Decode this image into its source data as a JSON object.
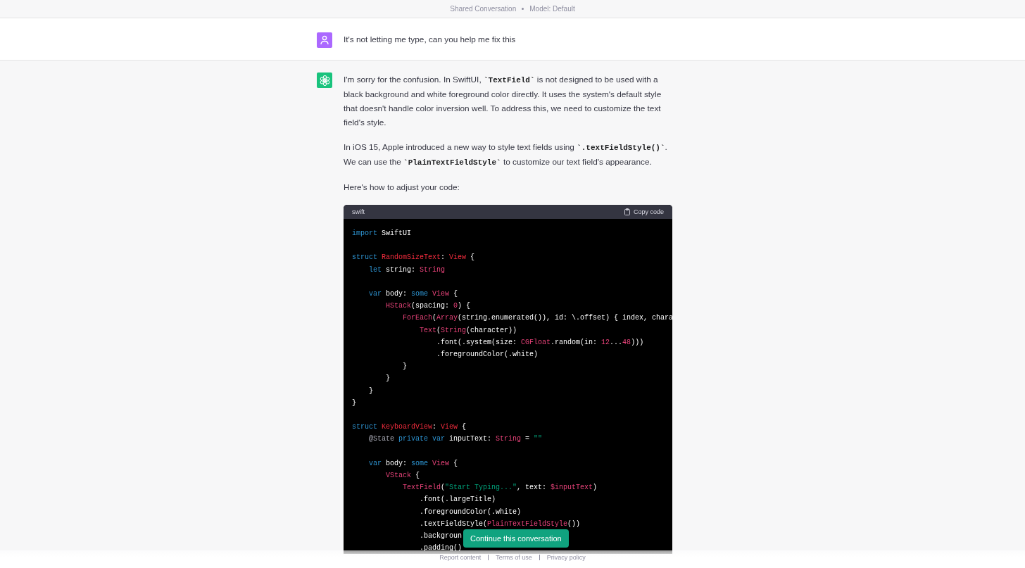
{
  "header": {
    "items": [
      "Shared Conversation",
      "Model: Default"
    ]
  },
  "messages": [
    {
      "kind": "user",
      "paragraphs": [
        [
          {
            "kind": "text",
            "text": "It's not letting me type, can you help me fix this"
          }
        ]
      ]
    },
    {
      "kind": "assistant",
      "paragraphs": [
        [
          {
            "kind": "text",
            "text": "I'm sorry for the confusion. In SwiftUI, "
          },
          {
            "kind": "code",
            "text": "`TextField`"
          },
          {
            "kind": "text",
            "text": " is not designed to be used with a black background and white foreground color directly. It uses the system's default style that doesn't handle color inversion well. To address this, we need to customize the text field's style."
          }
        ],
        [
          {
            "kind": "text",
            "text": "In iOS 15, Apple introduced a new way to style text fields using "
          },
          {
            "kind": "code",
            "text": "`.textFieldStyle()`"
          },
          {
            "kind": "text",
            "text": ". We can use the "
          },
          {
            "kind": "code",
            "text": "`PlainTextFieldStyle`"
          },
          {
            "kind": "text",
            "text": " to customize our text field's appearance."
          }
        ],
        [
          {
            "kind": "text",
            "text": "Here's how to adjust your code:"
          }
        ]
      ],
      "code_block": {
        "language": "swift",
        "copy_label": "Copy code",
        "lines": [
          {
            "tokens": [
              {
                "kind": "kw",
                "text": "import"
              },
              {
                "kind": "plain",
                "text": " SwiftUI"
              }
            ]
          },
          {
            "kind": "blank"
          },
          {
            "tokens": [
              {
                "kind": "kw",
                "text": "struct"
              },
              {
                "kind": "type",
                "text": " RandomSizeText"
              },
              {
                "kind": "plain",
                "text": ": "
              },
              {
                "kind": "type",
                "text": "View"
              },
              {
                "kind": "plain",
                "text": " {"
              }
            ]
          },
          {
            "tokens": [
              {
                "kind": "kw",
                "text": "    let"
              },
              {
                "kind": "plain",
                "text": " string: "
              },
              {
                "kind": "builtin",
                "text": "String"
              }
            ]
          },
          {
            "kind": "blank"
          },
          {
            "tokens": [
              {
                "kind": "kw",
                "text": "    var"
              },
              {
                "kind": "plain",
                "text": " body: "
              },
              {
                "kind": "kw",
                "text": "some"
              },
              {
                "kind": "builtin",
                "text": " View"
              },
              {
                "kind": "plain",
                "text": " {"
              }
            ]
          },
          {
            "tokens": [
              {
                "kind": "builtin",
                "text": "        HStack"
              },
              {
                "kind": "plain",
                "text": "(spacing: "
              },
              {
                "kind": "num",
                "text": "0"
              },
              {
                "kind": "plain",
                "text": ") {"
              }
            ]
          },
          {
            "tokens": [
              {
                "kind": "builtin",
                "text": "            ForEach"
              },
              {
                "kind": "plain",
                "text": "("
              },
              {
                "kind": "builtin",
                "text": "Array"
              },
              {
                "kind": "plain",
                "text": "(string.enumerated()), id: \\.offset) { index, chara"
              }
            ]
          },
          {
            "tokens": [
              {
                "kind": "builtin",
                "text": "                Text"
              },
              {
                "kind": "plain",
                "text": "("
              },
              {
                "kind": "builtin",
                "text": "String"
              },
              {
                "kind": "plain",
                "text": "(character))"
              }
            ]
          },
          {
            "tokens": [
              {
                "kind": "plain",
                "text": "                    .font(.system(size: "
              },
              {
                "kind": "builtin",
                "text": "CGFloat"
              },
              {
                "kind": "plain",
                "text": ".random(in: "
              },
              {
                "kind": "num",
                "text": "12"
              },
              {
                "kind": "plain",
                "text": "..."
              },
              {
                "kind": "num",
                "text": "48"
              },
              {
                "kind": "plain",
                "text": ")))"
              }
            ]
          },
          {
            "tokens": [
              {
                "kind": "plain",
                "text": "                    .foregroundColor(.white)"
              }
            ]
          },
          {
            "tokens": [
              {
                "kind": "plain",
                "text": "            }"
              }
            ]
          },
          {
            "tokens": [
              {
                "kind": "plain",
                "text": "        }"
              }
            ]
          },
          {
            "tokens": [
              {
                "kind": "plain",
                "text": "    }"
              }
            ]
          },
          {
            "tokens": [
              {
                "kind": "plain",
                "text": "}"
              }
            ]
          },
          {
            "kind": "blank"
          },
          {
            "tokens": [
              {
                "kind": "kw",
                "text": "struct"
              },
              {
                "kind": "type",
                "text": " KeyboardView"
              },
              {
                "kind": "plain",
                "text": ": "
              },
              {
                "kind": "type",
                "text": "View"
              },
              {
                "kind": "plain",
                "text": " {"
              }
            ]
          },
          {
            "tokens": [
              {
                "kind": "attr",
                "text": "    @State"
              },
              {
                "kind": "kw",
                "text": " private"
              },
              {
                "kind": "kw",
                "text": " var"
              },
              {
                "kind": "plain",
                "text": " inputText: "
              },
              {
                "kind": "builtin",
                "text": "String"
              },
              {
                "kind": "plain",
                "text": " = "
              },
              {
                "kind": "str",
                "text": "\"\""
              }
            ]
          },
          {
            "kind": "blank"
          },
          {
            "tokens": [
              {
                "kind": "kw",
                "text": "    var"
              },
              {
                "kind": "plain",
                "text": " body: "
              },
              {
                "kind": "kw",
                "text": "some"
              },
              {
                "kind": "builtin",
                "text": " View"
              },
              {
                "kind": "plain",
                "text": " {"
              }
            ]
          },
          {
            "tokens": [
              {
                "kind": "builtin",
                "text": "        VStack"
              },
              {
                "kind": "plain",
                "text": " {"
              }
            ]
          },
          {
            "tokens": [
              {
                "kind": "builtin",
                "text": "            TextField"
              },
              {
                "kind": "plain",
                "text": "("
              },
              {
                "kind": "str",
                "text": "\"Start Typing...\""
              },
              {
                "kind": "plain",
                "text": ", text: "
              },
              {
                "kind": "builtin",
                "text": "$inputText"
              },
              {
                "kind": "plain",
                "text": ")"
              }
            ]
          },
          {
            "tokens": [
              {
                "kind": "plain",
                "text": "                .font(.largeTitle)"
              }
            ]
          },
          {
            "tokens": [
              {
                "kind": "plain",
                "text": "                .foregroundColor(.white)"
              }
            ]
          },
          {
            "tokens": [
              {
                "kind": "plain",
                "text": "                .textFieldStyle("
              },
              {
                "kind": "builtin",
                "text": "PlainTextFieldStyle"
              },
              {
                "kind": "plain",
                "text": "())"
              }
            ]
          },
          {
            "tokens": [
              {
                "kind": "plain",
                "text": "                .backgroun"
              }
            ]
          },
          {
            "tokens": [
              {
                "kind": "plain",
                "text": "                .padding()"
              }
            ]
          }
        ]
      }
    }
  ],
  "continue_button": "Continue this conversation",
  "footer": {
    "links": [
      "Report content",
      "Terms of use",
      "Privacy policy"
    ]
  }
}
